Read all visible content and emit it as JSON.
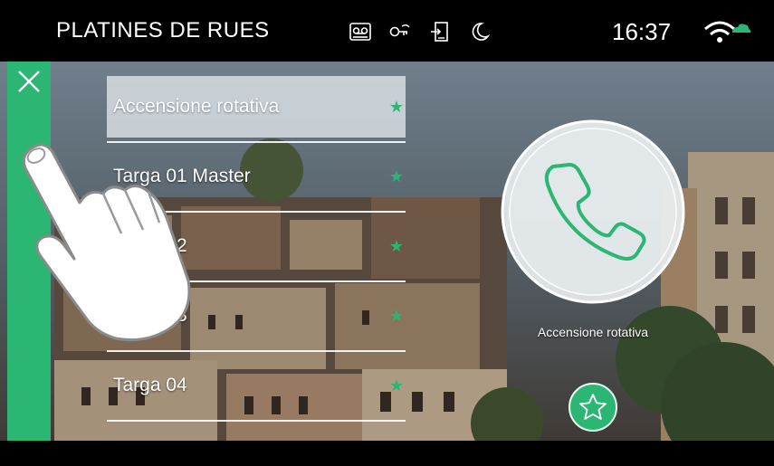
{
  "header": {
    "title": "PLATINES DE RUES",
    "time": "16:37",
    "status_icons": [
      "voicemail-icon",
      "key-icon",
      "door-icon",
      "moon-icon",
      "wifi-cloud-icon"
    ]
  },
  "colors": {
    "accent": "#2bb673",
    "topbar": "#000000"
  },
  "list": {
    "items": [
      {
        "label": "Accensione rotativa",
        "selected": true
      },
      {
        "label": "Targa 01 Master",
        "selected": false
      },
      {
        "label": "Targa 02",
        "selected": false
      },
      {
        "label": "Targa 03",
        "selected": false
      },
      {
        "label": "Targa 04",
        "selected": false
      }
    ]
  },
  "call": {
    "caption": "Accensione rotativa"
  }
}
